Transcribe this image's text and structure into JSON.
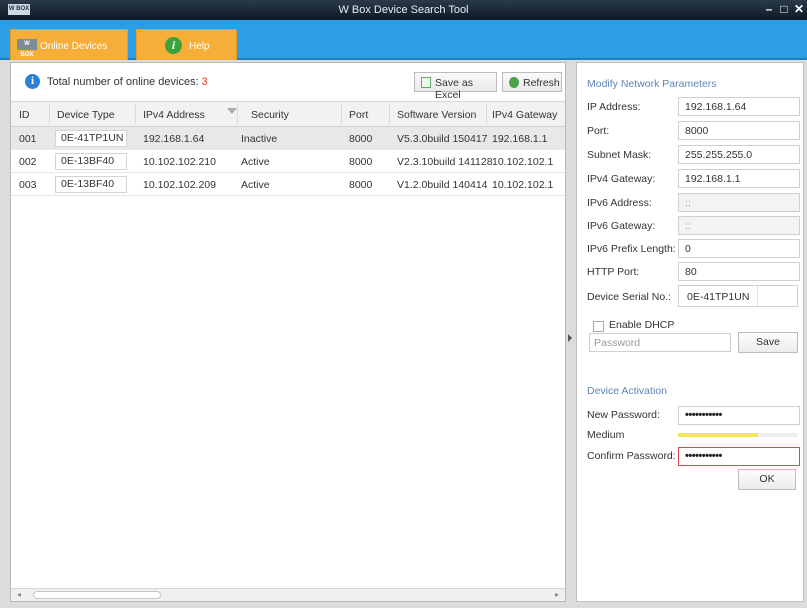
{
  "window": {
    "title": "W Box Device Search Tool",
    "logo_text": "W BOX"
  },
  "nav": {
    "online_devices": "Online Devices",
    "help": "Help",
    "tab_logo_text": "W BOX"
  },
  "toolbar": {
    "total_label": "Total number of online devices:",
    "total_count": "3",
    "save_excel": "Save as Excel",
    "refresh": "Refresh"
  },
  "table": {
    "headers": [
      "ID",
      "Device Type",
      "IPv4 Address",
      "Security",
      "Port",
      "Software Version",
      "IPv4 Gateway"
    ],
    "rows": [
      [
        "001",
        "0E-41TP1UN",
        "192.168.1.64",
        "Inactive",
        "8000",
        "V5.3.0build 150417",
        "192.168.1.1"
      ],
      [
        "002",
        "0E-13BF40",
        "10.102.102.210",
        "Active",
        "8000",
        "V2.3.10build 141128",
        "10.102.102.1"
      ],
      [
        "003",
        "0E-13BF40",
        "10.102.102.209",
        "Active",
        "8000",
        "V1.2.0build 140414",
        "10.102.102.1"
      ]
    ]
  },
  "network": {
    "title": "Modify Network Parameters",
    "fields": [
      {
        "label": "IP Address:",
        "value": "192.168.1.64"
      },
      {
        "label": "Port:",
        "value": "8000"
      },
      {
        "label": "Subnet Mask:",
        "value": "255.255.255.0"
      },
      {
        "label": "IPv4 Gateway:",
        "value": "192.168.1.1"
      },
      {
        "label": "IPv6 Address:",
        "value": "::"
      },
      {
        "label": "IPv6 Gateway:",
        "value": "::"
      },
      {
        "label": "IPv6 Prefix Length:",
        "value": "0"
      },
      {
        "label": "HTTP Port:",
        "value": "80"
      }
    ],
    "serial_label": "Device Serial No.:",
    "serial_value": "0E-41TP1UN",
    "dhcp_label": "Enable DHCP",
    "dhcp_checked": false,
    "password_placeholder": "Password",
    "save": "Save"
  },
  "activation": {
    "title": "Device Activation",
    "new_password_label": "New Password:",
    "new_password_value": "•••••••••••",
    "strength_label": "Medium",
    "strength_level": 0.67,
    "strength_color": "#f3e55a",
    "confirm_password_label": "Confirm Password:",
    "confirm_password_value": "•••••••••••",
    "ok": "OK"
  },
  "colors": {
    "nav_blue": "#2b9ee6",
    "tab_orange": "#f6ae38",
    "count_red": "#e03b2d",
    "section_blue": "#5c86b8"
  }
}
